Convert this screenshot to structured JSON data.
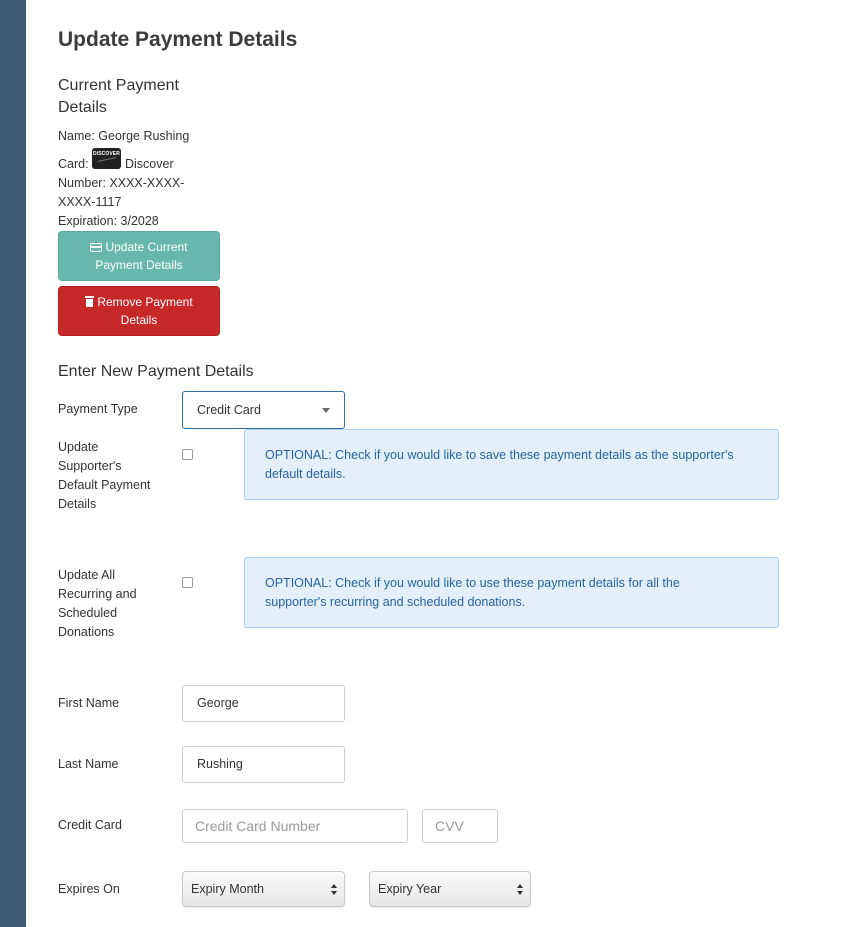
{
  "page": {
    "title": "Update Payment Details"
  },
  "current": {
    "title": "Current Payment Details",
    "name_line": "Name: George Rushing",
    "card_label": "Card:",
    "card_brand": "Discover",
    "card_logo_text": "DISCOVER",
    "number_line1": "Number: XXXX-XXXX-",
    "number_line2": "XXXX-1117",
    "expiration_line": "Expiration: 3/2028",
    "update_button_line1": "Update Current",
    "update_button_line2": "Payment Details",
    "remove_button_line1": "Remove Payment",
    "remove_button_line2": "Details"
  },
  "new_payment": {
    "title": "Enter New Payment Details",
    "payment_type_label": "Payment Type",
    "payment_type_value": "Credit Card",
    "default_label": [
      "Update",
      "Supporter's",
      "Default Payment",
      "Details"
    ],
    "default_checked": false,
    "default_hint_line1": "OPTIONAL: Check if you would like to save these payment details as the supporter's",
    "default_hint_line2": "default details.",
    "recurring_label": [
      "Update All",
      "Recurring and",
      "Scheduled",
      "Donations"
    ],
    "recurring_checked": false,
    "recurring_hint_line1": "OPTIONAL: Check if you would like to use these payment details for all the",
    "recurring_hint_line2": "supporter's recurring and scheduled donations.",
    "first_name_label": "First Name",
    "first_name_value": "George",
    "last_name_label": "Last Name",
    "last_name_value": "Rushing",
    "credit_card_label": "Credit Card",
    "card_number_placeholder": "Credit Card Number",
    "cvv_placeholder": "CVV",
    "expires_label": "Expires On",
    "expiry_month_value": "Expiry Month",
    "expiry_year_value": "Expiry Year"
  },
  "colors": {
    "sidebar": "#3d5a74",
    "update_button": "#67b7ae",
    "remove_button": "#c6282a",
    "alert_bg": "#e3f0fb",
    "alert_text": "#2a62a0"
  }
}
